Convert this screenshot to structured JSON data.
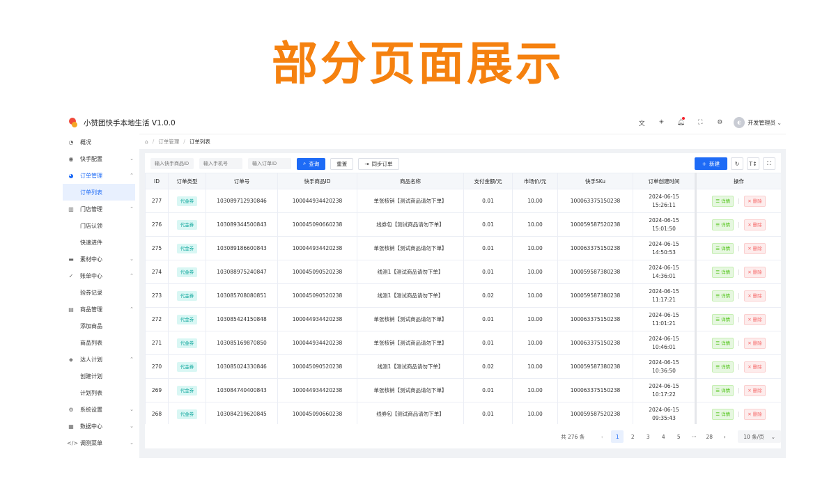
{
  "banner": {
    "title": "部分页面展示"
  },
  "header": {
    "app_title": "小赞团快手本地生活 V1.0.0",
    "user_name": "开发管理员",
    "icons": [
      "translate-icon",
      "theme-icon",
      "bell-icon",
      "fullscreen-icon",
      "settings-icon"
    ]
  },
  "sidebar": {
    "items": [
      {
        "label": "概况",
        "icon": "dashboard-icon",
        "level": 0
      },
      {
        "label": "快手配置",
        "icon": "config-icon",
        "level": 0,
        "arrow": "⌄"
      },
      {
        "label": "订单管理",
        "icon": "order-icon",
        "level": 0,
        "arrow": "⌃",
        "active": true
      },
      {
        "label": "订单列表",
        "level": 1,
        "selected": true
      },
      {
        "label": "门店管理",
        "icon": "store-icon",
        "level": 0,
        "arrow": "⌃"
      },
      {
        "label": "门店认领",
        "level": 1
      },
      {
        "label": "快速进件",
        "level": 1
      },
      {
        "label": "素材中心",
        "icon": "material-icon",
        "level": 0,
        "arrow": "⌄"
      },
      {
        "label": "账单中心",
        "icon": "bill-icon",
        "level": 0,
        "arrow": "⌃"
      },
      {
        "label": "验券记录",
        "level": 1
      },
      {
        "label": "商品管理",
        "icon": "goods-icon",
        "level": 0,
        "arrow": "⌃"
      },
      {
        "label": "添加商品",
        "level": 1
      },
      {
        "label": "商品列表",
        "level": 1
      },
      {
        "label": "达人计划",
        "icon": "cube-icon",
        "level": 0,
        "arrow": "⌃"
      },
      {
        "label": "创建计划",
        "level": 1
      },
      {
        "label": "计划列表",
        "level": 1
      },
      {
        "label": "系统设置",
        "icon": "gear-icon",
        "level": 0,
        "arrow": "⌄"
      },
      {
        "label": "数据中心",
        "icon": "data-icon",
        "level": 0,
        "arrow": "⌄"
      },
      {
        "label": "调测菜单",
        "icon": "code-icon",
        "level": 0,
        "arrow": "⌄"
      }
    ]
  },
  "breadcrumb": {
    "parent": "订单管理",
    "current": "订单列表"
  },
  "toolbar": {
    "placeholder_goods": "输入快手商品ID",
    "placeholder_phone": "输入手机号",
    "placeholder_order": "输入订单ID",
    "query": "查询",
    "reset": "重置",
    "sync": "同步订单",
    "new": "新建"
  },
  "table": {
    "columns": [
      "ID",
      "订单类型",
      "订单号",
      "快手商品ID",
      "商品名称",
      "支付金额/元",
      "市场价/元",
      "快手SKu",
      "订单创建时间",
      "操作"
    ],
    "detail_label": "☰ 详情",
    "delete_label": "✕ 删除",
    "rows": [
      [
        "277",
        "代金券",
        "103089712930846",
        "100044934420238",
        "单张核销【测试商品请勿下单】",
        "0.01",
        "10.00",
        "100063375150238",
        "2024-06-15 15:26:11"
      ],
      [
        "276",
        "代金券",
        "103089344500843",
        "100045090660238",
        "线券包【测试商品请勿下单】",
        "0.01",
        "10.00",
        "100059587520238",
        "2024-06-15 15:01:50"
      ],
      [
        "275",
        "代金券",
        "103089186600843",
        "100044934420238",
        "单张核销【测试商品请勿下单】",
        "0.01",
        "10.00",
        "100063375150238",
        "2024-06-15 14:50:53"
      ],
      [
        "274",
        "代金券",
        "103088975240847",
        "100045090520238",
        "线测1【测试商品请勿下单】",
        "0.01",
        "10.00",
        "100059587380238",
        "2024-06-15 14:36:01"
      ],
      [
        "273",
        "代金券",
        "103085708080851",
        "100045090520238",
        "线测1【测试商品请勿下单】",
        "0.02",
        "10.00",
        "100059587380238",
        "2024-06-15 11:17:21"
      ],
      [
        "272",
        "代金券",
        "103085424150848",
        "100044934420238",
        "单张核销【测试商品请勿下单】",
        "0.01",
        "10.00",
        "100063375150238",
        "2024-06-15 11:01:21"
      ],
      [
        "271",
        "代金券",
        "103085169870850",
        "100044934420238",
        "单张核销【测试商品请勿下单】",
        "0.01",
        "10.00",
        "100063375150238",
        "2024-06-15 10:46:01"
      ],
      [
        "270",
        "代金券",
        "103085024330846",
        "100045090520238",
        "线测1【测试商品请勿下单】",
        "0.02",
        "10.00",
        "100059587380238",
        "2024-06-15 10:36:50"
      ],
      [
        "269",
        "代金券",
        "103084740400843",
        "100044934420238",
        "单张核销【测试商品请勿下单】",
        "0.01",
        "10.00",
        "100063375150238",
        "2024-06-15 10:17:22"
      ],
      [
        "268",
        "代金券",
        "103084219620845",
        "100045090660238",
        "线券包【测试商品请勿下单】",
        "0.01",
        "10.00",
        "100059587520238",
        "2024-06-15 09:35:43"
      ]
    ]
  },
  "pagination": {
    "total": "共 276 条",
    "pages": [
      "1",
      "2",
      "3",
      "4",
      "5",
      "···",
      "28"
    ],
    "current": "1",
    "page_size": "10 条/页"
  }
}
